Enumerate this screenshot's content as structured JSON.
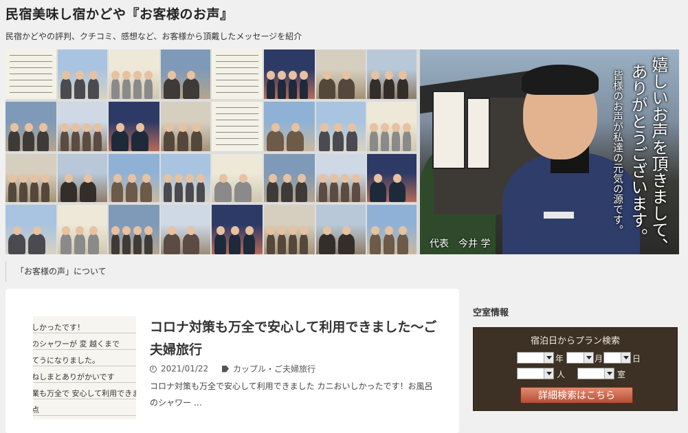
{
  "site": {
    "title": "民宿美味し宿かどや『お客様のお声』",
    "description": "民宿かどやの評判、クチコミ、感想など、お客様から頂戴したメッセージを紹介"
  },
  "banner": {
    "message_line1": "嬉しいお声を頂きまして、",
    "message_line2": "ありがとうございます。",
    "message_line3": "皆様のお声が私達の元気の源です。",
    "representative": "代表　今井 学"
  },
  "breadcrumb": {
    "label": "「お客様の声」について"
  },
  "post": {
    "title": "コロナ対策も万全で安心して利用できました〜ご夫婦旅行",
    "date": "2021/01/22",
    "category": "カップル・ご夫婦旅行",
    "excerpt": "コロナ対策も万全で安心して利用できました カニおいしかったです！お風呂のシャワー …",
    "thumbnail_lines": [
      "しかったです！",
      "のシャワーが 変 越くまで",
      "てうになりました。",
      "ねしまとありがかいです",
      "業も万全で 安心して利用できまし",
      "点"
    ]
  },
  "sidebar": {
    "heading": "空室情報",
    "search": {
      "title": "宿泊日からプラン検索",
      "year_unit": "年",
      "month_unit": "月",
      "day_unit": "日",
      "people_unit": "人",
      "room_unit": "室",
      "button_label": "詳細検索はこちら"
    }
  },
  "colors": {
    "page_bg": "#f0f0f0",
    "search_bg": "#3d3024",
    "button_bg": "#c9604a",
    "card_bg": "#ffffff"
  }
}
